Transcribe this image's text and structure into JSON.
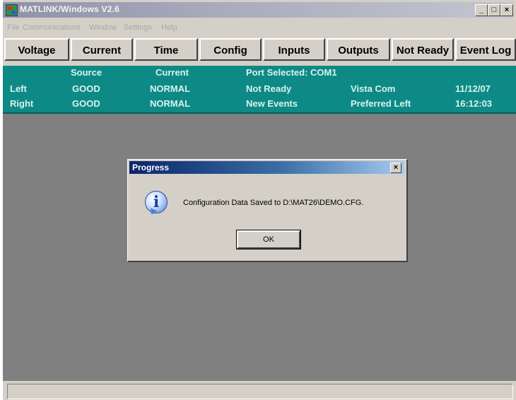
{
  "window": {
    "title": "MATLINK/Windows V2.6"
  },
  "menu": [
    "File",
    "Communications",
    "Window",
    "Settings",
    "Help"
  ],
  "toolbar": [
    "Voltage",
    "Current",
    "Time",
    "Config",
    "Inputs",
    "Outputs",
    "Not Ready",
    "Event Log"
  ],
  "status": {
    "header_source": "Source",
    "header_current": "Current",
    "port_selected": "Port Selected: COM1",
    "left": {
      "label": "Left",
      "source": "GOOD",
      "current": "NORMAL",
      "state": "Not Ready",
      "info": "Vista Com",
      "value": "11/12/07"
    },
    "right": {
      "label": "Right",
      "source": "GOOD",
      "current": "NORMAL",
      "state": "New Events",
      "info": "Preferred Left",
      "value": "16:12:03"
    },
    "text_color": "#d9f2ee",
    "panel_color": "#0d8a85"
  },
  "dialog": {
    "title": "Progress",
    "message": "Configuration Data Saved to D:\\MAT26\\DEMO.CFG.",
    "ok_label": "OK",
    "icon": "info-icon"
  },
  "window_controls": {
    "minimize": "_",
    "maximize": "□",
    "close": "×"
  }
}
